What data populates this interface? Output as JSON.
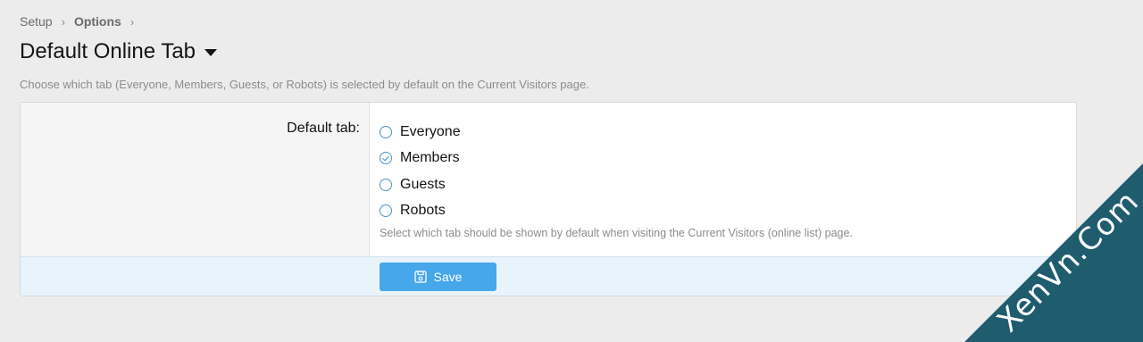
{
  "breadcrumb": {
    "items": [
      "Setup",
      "Options"
    ]
  },
  "page": {
    "title": "Default Online Tab",
    "description": "Choose which tab (Everyone, Members, Guests, or Robots) is selected by default on the Current Visitors page."
  },
  "form": {
    "field_label": "Default tab:",
    "options": [
      {
        "label": "Everyone",
        "checked": false
      },
      {
        "label": "Members",
        "checked": true
      },
      {
        "label": "Guests",
        "checked": false
      },
      {
        "label": "Robots",
        "checked": false
      }
    ],
    "explain": "Select which tab should be shown by default when visiting the Current Visitors (online list) page.",
    "save_label": "Save"
  },
  "watermark": {
    "text": "XenVn.Com"
  },
  "colors": {
    "accent": "#47a7eb",
    "radio": "#4a94c9",
    "submit_bg": "#e8f3fb"
  }
}
